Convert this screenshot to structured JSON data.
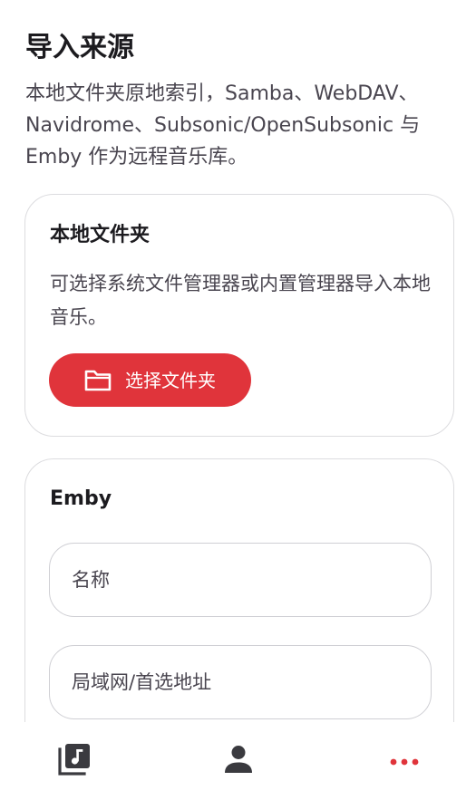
{
  "header": {
    "title": "导入来源",
    "description": "本地文件夹原地索引，Samba、WebDAV、Navidrome、Subsonic/OpenSubsonic 与 Emby 作为远程音乐库。"
  },
  "local_folder_card": {
    "title": "本地文件夹",
    "description": "可选择系统文件管理器或内置管理器导入本地音乐。",
    "button_label": "选择文件夹",
    "button_icon": "folder-icon"
  },
  "emby_card": {
    "title": "Emby",
    "fields": [
      {
        "placeholder": "名称",
        "value": ""
      },
      {
        "placeholder": "局域网/首选地址",
        "value": ""
      }
    ]
  },
  "bottom_nav": {
    "items": [
      {
        "icon": "music-library-icon",
        "selected": false
      },
      {
        "icon": "person-icon",
        "selected": false
      },
      {
        "icon": "more-horizontal-icon",
        "selected": true
      }
    ]
  },
  "colors": {
    "accent": "#e0343b",
    "text_primary": "#1c1b1f",
    "text_secondary": "#49454f",
    "outline": "#dcdcdf",
    "icon_default": "#3a3a3f"
  }
}
